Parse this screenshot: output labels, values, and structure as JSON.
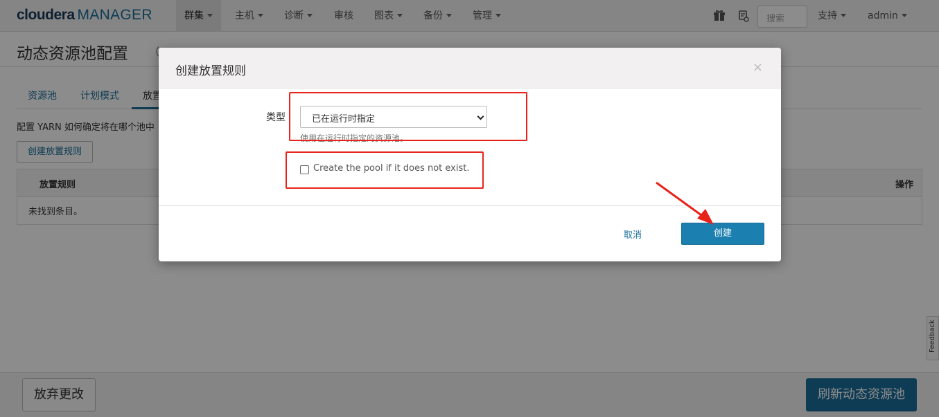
{
  "app": {
    "logo_brand": "cloudera",
    "logo_product": "MANAGER"
  },
  "nav": {
    "items": [
      {
        "label": "群集",
        "active": true
      },
      {
        "label": "主机"
      },
      {
        "label": "诊断"
      },
      {
        "label": "审核"
      },
      {
        "label": "图表"
      },
      {
        "label": "备份"
      },
      {
        "label": "管理"
      }
    ],
    "search_placeholder": "搜索",
    "support_label": "支持",
    "user_label": "admin"
  },
  "page": {
    "title": "动态资源池配置",
    "subtitle_fragment": "（",
    "tabs": [
      {
        "label": "资源池"
      },
      {
        "label": "计划模式"
      },
      {
        "label": "放置",
        "active": true
      }
    ],
    "description": "配置 YARN 如何确定将在哪个池中",
    "create_rule_button": "创建放置规则",
    "table": {
      "headers": [
        "放置规则",
        "操作"
      ],
      "empty_text": "未找到条目。"
    }
  },
  "footer": {
    "discard_button": "放弃更改",
    "refresh_button": "刷新动态资源池",
    "feedback_label": "Feedback"
  },
  "modal": {
    "title": "创建放置规则",
    "close_glyph": "×",
    "type_label": "类型",
    "type_selected": "已在运行时指定",
    "type_help": "使用在运行时指定的资源池。",
    "create_pool_checkbox_label": "Create the pool if it does not exist.",
    "create_pool_checked": false,
    "cancel_button": "取消",
    "create_button": "创建"
  },
  "annotation": {
    "color": "#e8231a"
  }
}
